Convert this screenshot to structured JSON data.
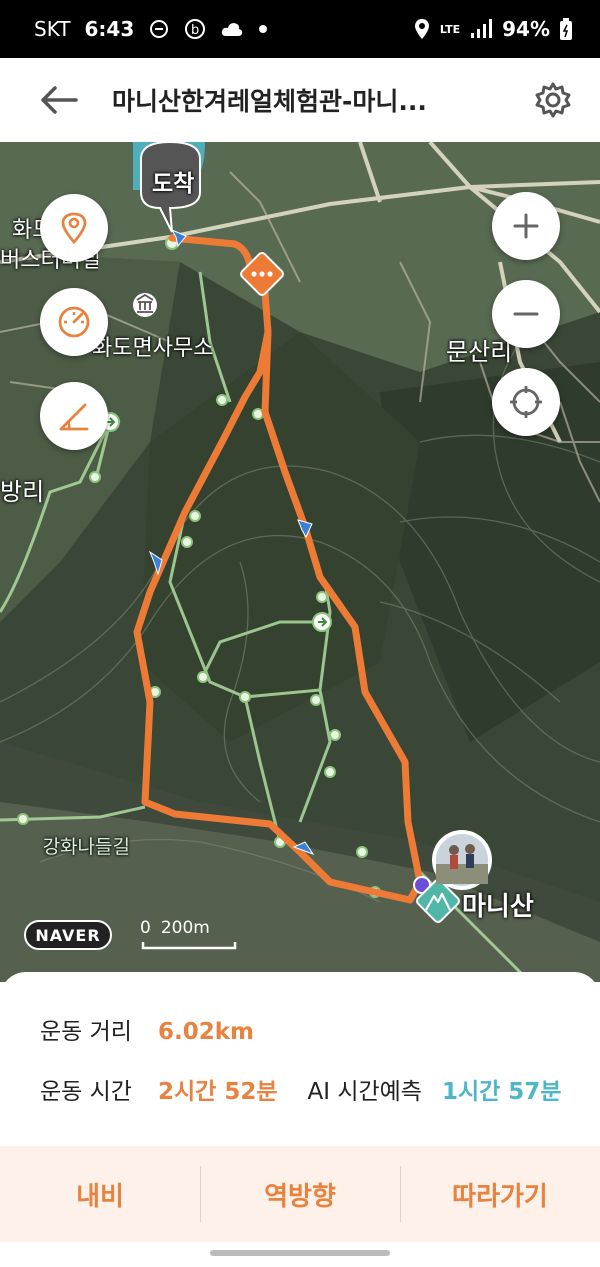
{
  "status_bar": {
    "carrier": "SKT",
    "time": "6:43",
    "network": "LTE",
    "battery": "94%"
  },
  "header": {
    "title": "마니산한겨레얼체험관-마니...",
    "back_icon": "arrow-left-icon",
    "settings_icon": "gear-icon"
  },
  "map": {
    "arrival_marker": "도착",
    "place_labels": [
      "화도",
      "버스터미널",
      "화도면사무소",
      "문산리",
      "방리",
      "강화나들길",
      "마니산"
    ],
    "provider": "NAVER",
    "scale": "200m",
    "route_color": "#ee7b35",
    "trail_color": "#a8d59a"
  },
  "stats": {
    "distance_label": "운동 거리",
    "distance_value": "6.02km",
    "time_label": "운동 시간",
    "time_value": "2시간 52분",
    "ai_label": "AI 시간예측",
    "ai_value": "1시간 57분"
  },
  "actions": {
    "nav": "내비",
    "reverse": "역방향",
    "follow": "따라가기"
  },
  "colors": {
    "accent": "#e8823f",
    "ai": "#4fb6c8"
  }
}
